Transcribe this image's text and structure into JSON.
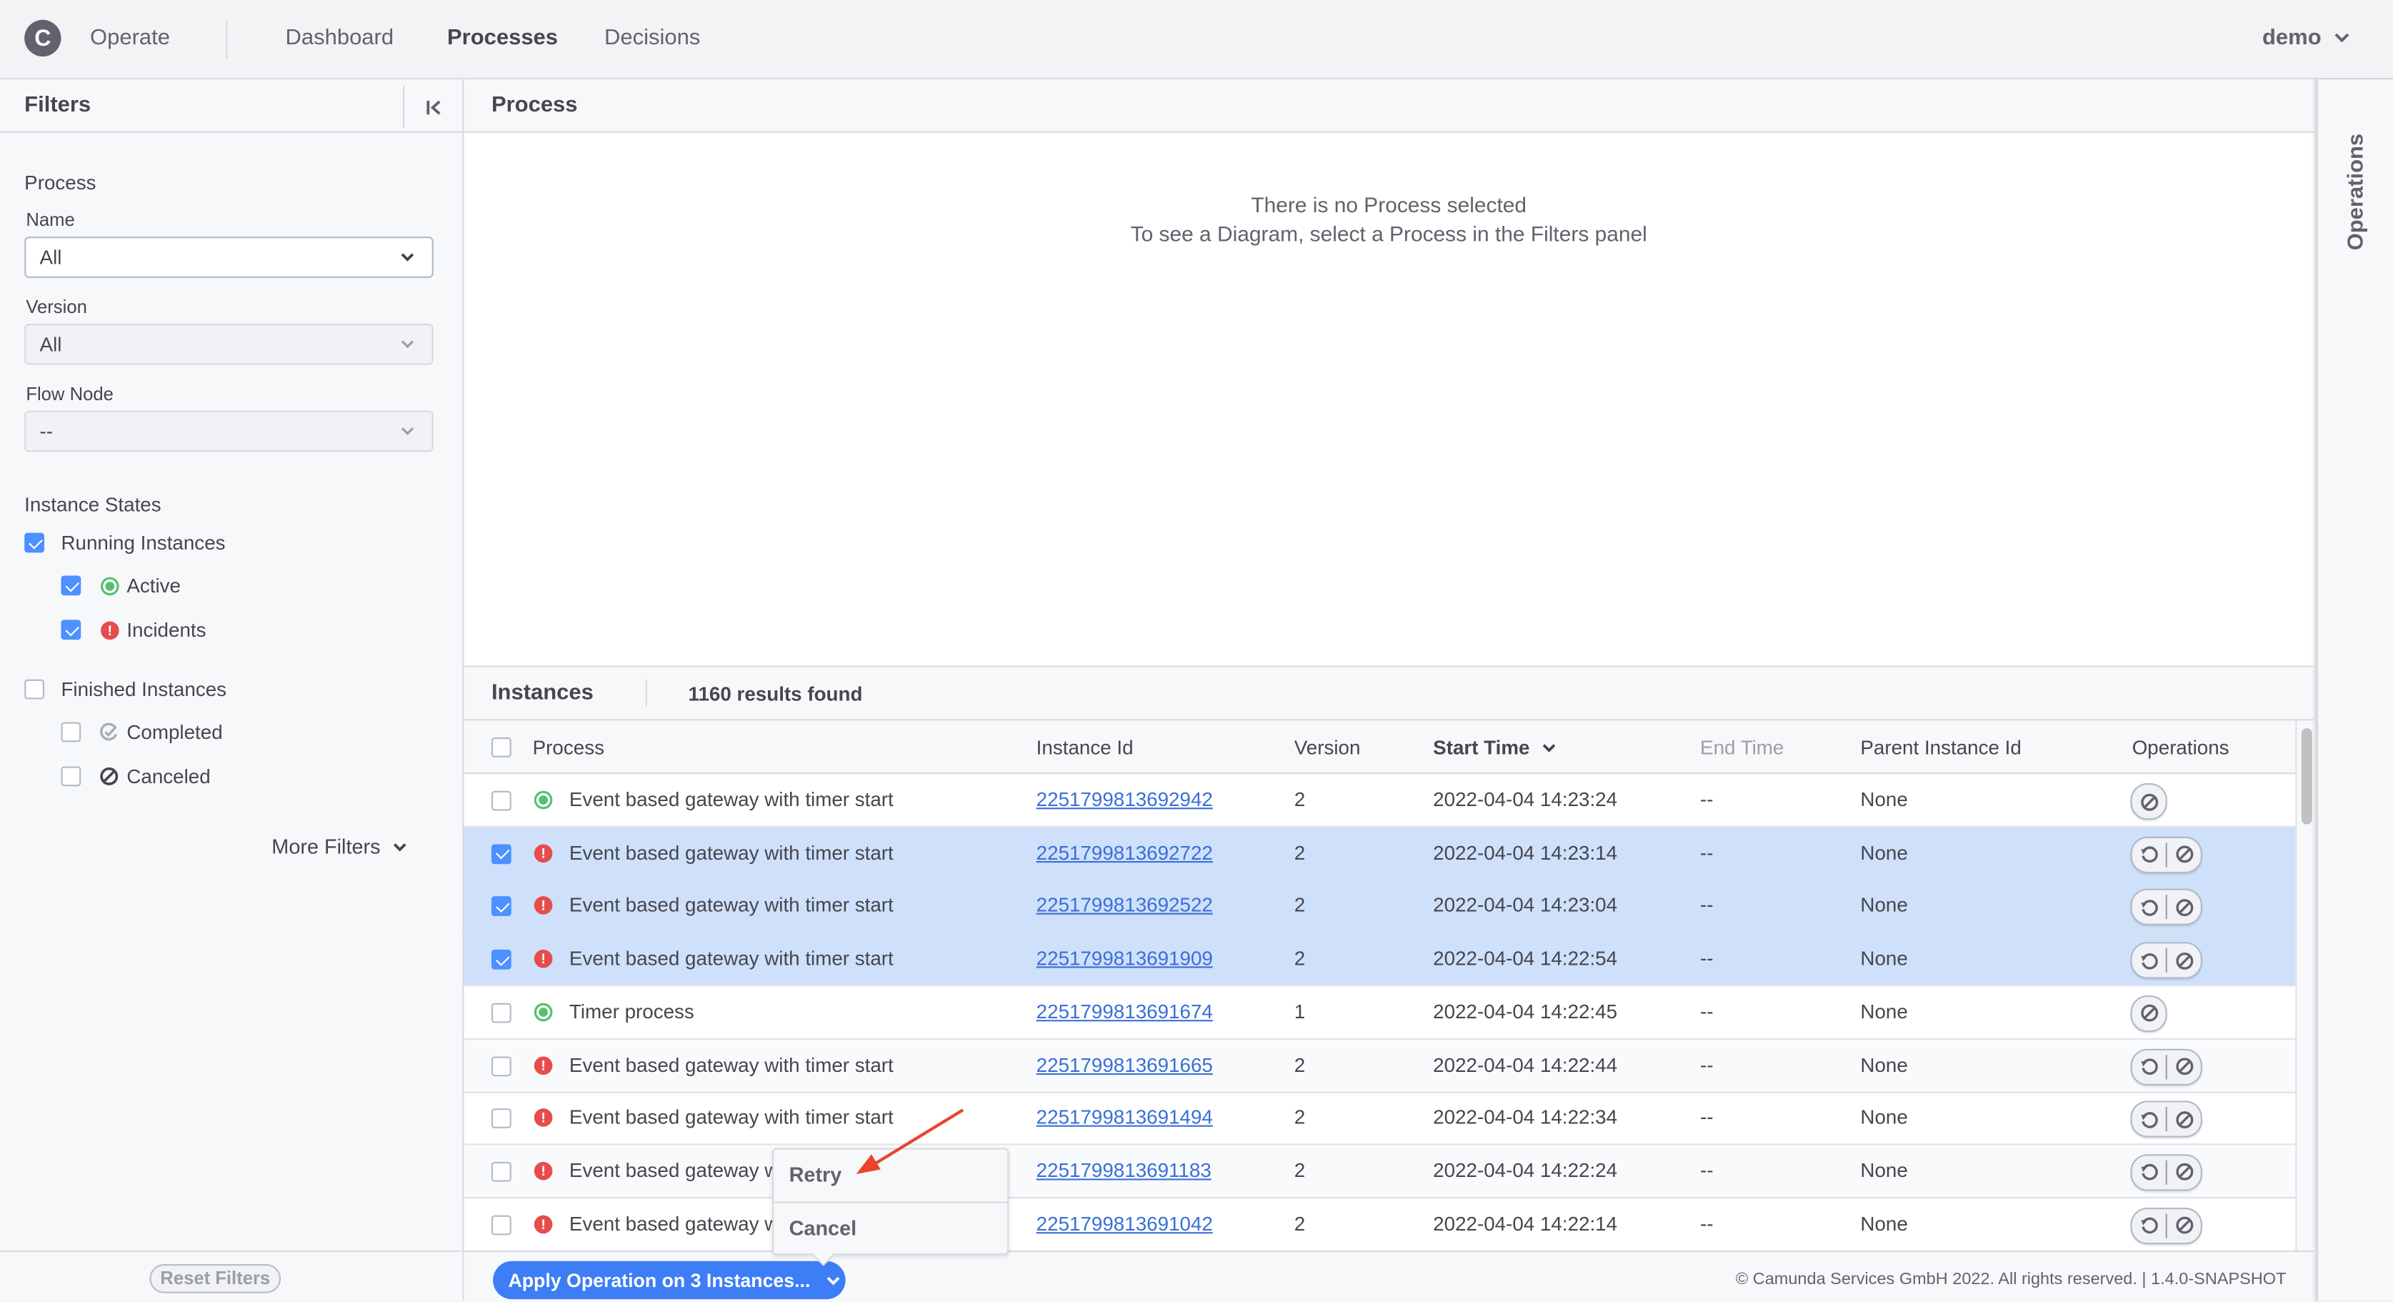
{
  "header": {
    "logo_letter": "C",
    "app_name": "Operate",
    "nav": [
      {
        "label": "Dashboard",
        "active": false
      },
      {
        "label": "Processes",
        "active": true
      },
      {
        "label": "Decisions",
        "active": false
      }
    ],
    "user": "demo"
  },
  "filters": {
    "title": "Filters",
    "process_section": "Process",
    "name_label": "Name",
    "name_value": "All",
    "version_label": "Version",
    "version_value": "All",
    "flow_node_label": "Flow Node",
    "flow_node_value": "--",
    "instance_states_label": "Instance States",
    "states": [
      {
        "label": "Running Instances",
        "checked": true
      },
      {
        "label": "Active",
        "checked": true,
        "icon": "active-icon"
      },
      {
        "label": "Incidents",
        "checked": true,
        "icon": "incident-icon"
      },
      {
        "label": "Finished Instances",
        "checked": false
      },
      {
        "label": "Completed",
        "checked": false,
        "icon": "completed-icon"
      },
      {
        "label": "Canceled",
        "checked": false,
        "icon": "canceled-icon"
      }
    ],
    "more_filters": "More Filters",
    "reset": "Reset Filters"
  },
  "process_panel": {
    "title": "Process",
    "empty_line1": "There is no Process selected",
    "empty_line2": "To see a Diagram, select a Process in the Filters panel"
  },
  "instances": {
    "title": "Instances",
    "count": "1160 results found",
    "columns": [
      "Process",
      "Instance Id",
      "Version",
      "Start Time",
      "End Time",
      "Parent Instance Id",
      "Operations"
    ],
    "sort_column": "Start Time",
    "rows": [
      {
        "state": "active",
        "selected": false,
        "process": "Event based gateway with timer start",
        "id": "2251799813692942",
        "version": "2",
        "start": "2022-04-04 14:23:24",
        "end": "--",
        "parent": "None",
        "ops": [
          "cancel"
        ]
      },
      {
        "state": "incident",
        "selected": true,
        "process": "Event based gateway with timer start",
        "id": "2251799813692722",
        "version": "2",
        "start": "2022-04-04 14:23:14",
        "end": "--",
        "parent": "None",
        "ops": [
          "retry",
          "cancel"
        ]
      },
      {
        "state": "incident",
        "selected": true,
        "process": "Event based gateway with timer start",
        "id": "2251799813692522",
        "version": "2",
        "start": "2022-04-04 14:23:04",
        "end": "--",
        "parent": "None",
        "ops": [
          "retry",
          "cancel"
        ]
      },
      {
        "state": "incident",
        "selected": true,
        "process": "Event based gateway with timer start",
        "id": "2251799813691909",
        "version": "2",
        "start": "2022-04-04 14:22:54",
        "end": "--",
        "parent": "None",
        "ops": [
          "retry",
          "cancel"
        ]
      },
      {
        "state": "active",
        "selected": false,
        "process": "Timer process",
        "id": "2251799813691674",
        "version": "1",
        "start": "2022-04-04 14:22:45",
        "end": "--",
        "parent": "None",
        "ops": [
          "cancel"
        ]
      },
      {
        "state": "incident",
        "selected": false,
        "process": "Event based gateway with timer start",
        "id": "2251799813691665",
        "version": "2",
        "start": "2022-04-04 14:22:44",
        "end": "--",
        "parent": "None",
        "ops": [
          "retry",
          "cancel"
        ]
      },
      {
        "state": "incident",
        "selected": false,
        "process": "Event based gateway with timer start",
        "id": "2251799813691494",
        "version": "2",
        "start": "2022-04-04 14:22:34",
        "end": "--",
        "parent": "None",
        "ops": [
          "retry",
          "cancel"
        ]
      },
      {
        "state": "incident",
        "selected": false,
        "process": "Event based gateway with timer start",
        "id": "2251799813691183",
        "version": "2",
        "start": "2022-04-04 14:22:24",
        "end": "--",
        "parent": "None",
        "ops": [
          "retry",
          "cancel"
        ]
      },
      {
        "state": "incident",
        "selected": false,
        "process": "Event based gateway with timer start",
        "id": "2251799813691042",
        "version": "2",
        "start": "2022-04-04 14:22:14",
        "end": "--",
        "parent": "None",
        "ops": [
          "retry",
          "cancel"
        ]
      }
    ],
    "apply_button": "Apply Operation on 3 Instances...",
    "menu": [
      "Retry",
      "Cancel"
    ],
    "copyright": "© Camunda Services GmbH 2022. All rights reserved. | 1.4.0-SNAPSHOT"
  },
  "operations_panel": {
    "title": "Operations"
  },
  "colors": {
    "accent": "#3d7df5",
    "checkbox": "#4d90ff",
    "active": "#56c070",
    "incident": "#e74c4c",
    "selected_row": "#cfe0fa",
    "link": "#3a6fd8",
    "annotation_arrow": "#e8452c"
  }
}
